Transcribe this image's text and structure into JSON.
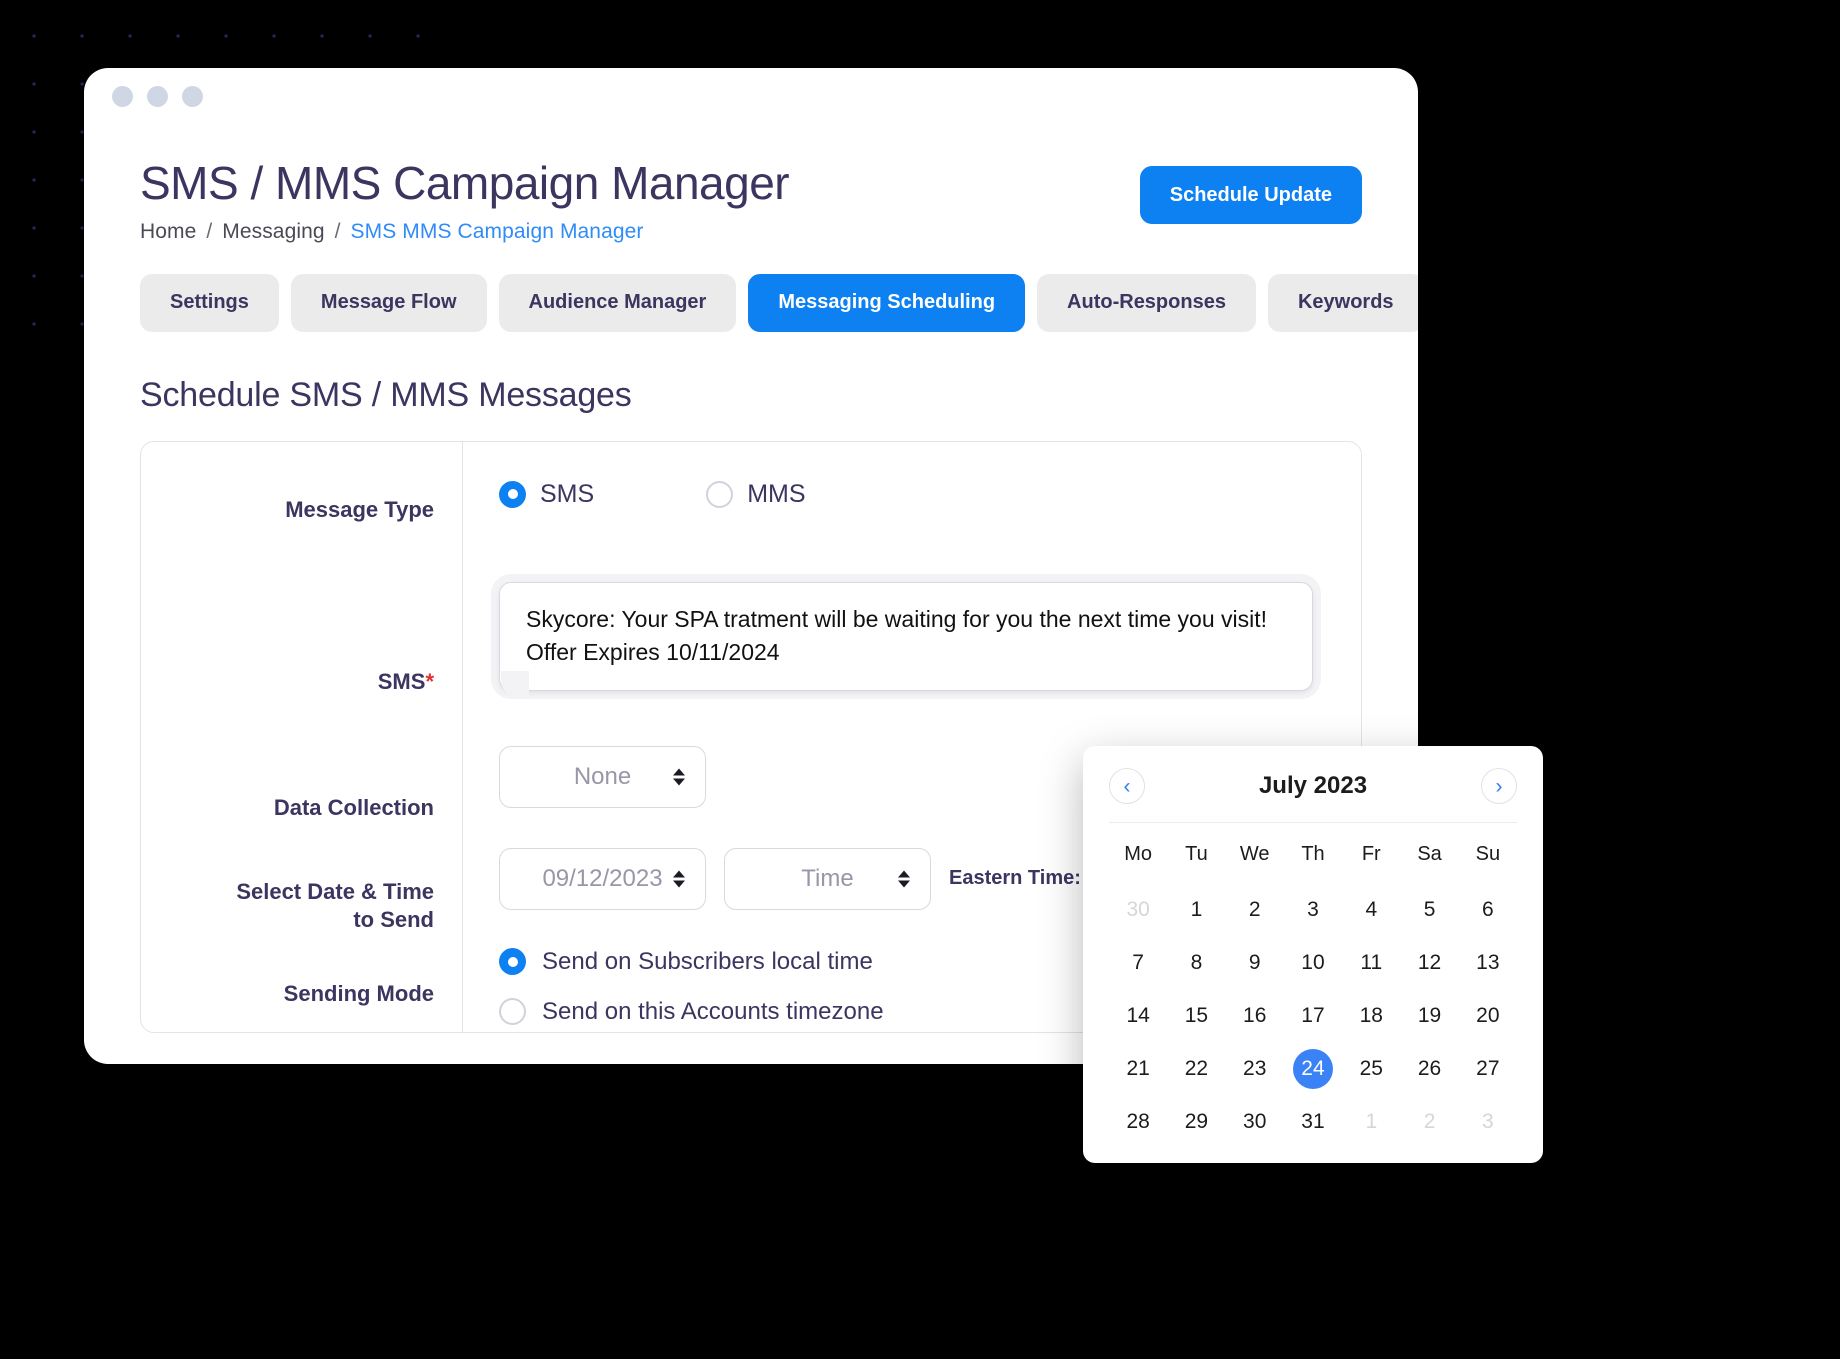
{
  "window": {
    "dots": [
      "dot-1",
      "dot-2",
      "dot-3"
    ]
  },
  "header": {
    "title": "SMS / MMS Campaign Manager",
    "breadcrumb": {
      "home": "Home",
      "section": "Messaging",
      "current": "SMS MMS Campaign Manager",
      "separator": "/"
    },
    "primary_button": "Schedule Update",
    "accent_color": "#0d80f2",
    "title_color": "#3b3560",
    "link_color": "#2f8cf7"
  },
  "tabs": [
    {
      "label": "Settings",
      "active": false
    },
    {
      "label": "Message Flow",
      "active": false
    },
    {
      "label": "Audience Manager",
      "active": false
    },
    {
      "label": "Messaging Scheduling",
      "active": true
    },
    {
      "label": "Auto-Responses",
      "active": false
    },
    {
      "label": "Keywords",
      "active": false
    }
  ],
  "section": {
    "title": "Schedule SMS / MMS Messages"
  },
  "form": {
    "message_type": {
      "label": "Message Type",
      "options": [
        {
          "label": "SMS",
          "checked": true
        },
        {
          "label": "MMS",
          "checked": false
        }
      ]
    },
    "sms": {
      "label": "SMS",
      "required_marker": "*",
      "required_color": "#e03131",
      "value": "Skycore: Your SPA tratment will be waiting for you the next time you visit! Offer Expires 10/11/2024"
    },
    "data_collection": {
      "label": "Data Collection",
      "value": "None"
    },
    "date_time": {
      "label_line1": "Select Date & Time",
      "label_line2": "to Send",
      "date_value": "09/12/2023",
      "time_placeholder": "Time",
      "timezone_note": "Eastern Time: US"
    },
    "sending_mode": {
      "label": "Sending Mode",
      "options": [
        {
          "label": "Send on Subscribers local time",
          "checked": true
        },
        {
          "label": "Send on this Accounts timezone",
          "checked": false
        }
      ]
    }
  },
  "calendar": {
    "month_title": "July 2023",
    "prev_label": "‹",
    "next_label": "›",
    "weekdays": [
      "Mo",
      "Tu",
      "We",
      "Th",
      "Fr",
      "Sa",
      "Su"
    ],
    "selected_day": 24,
    "selected_color": "#3b82f6",
    "days": [
      {
        "n": "30",
        "muted": true
      },
      {
        "n": "1",
        "muted": false
      },
      {
        "n": "2",
        "muted": false
      },
      {
        "n": "3",
        "muted": false
      },
      {
        "n": "4",
        "muted": false
      },
      {
        "n": "5",
        "muted": false
      },
      {
        "n": "6",
        "muted": false
      },
      {
        "n": "7",
        "muted": false
      },
      {
        "n": "8",
        "muted": false
      },
      {
        "n": "9",
        "muted": false
      },
      {
        "n": "10",
        "muted": false
      },
      {
        "n": "11",
        "muted": false
      },
      {
        "n": "12",
        "muted": false
      },
      {
        "n": "13",
        "muted": false
      },
      {
        "n": "14",
        "muted": false
      },
      {
        "n": "15",
        "muted": false
      },
      {
        "n": "16",
        "muted": false
      },
      {
        "n": "17",
        "muted": false
      },
      {
        "n": "18",
        "muted": false
      },
      {
        "n": "19",
        "muted": false
      },
      {
        "n": "20",
        "muted": false
      },
      {
        "n": "21",
        "muted": false
      },
      {
        "n": "22",
        "muted": false
      },
      {
        "n": "23",
        "muted": false
      },
      {
        "n": "24",
        "muted": false,
        "selected": true
      },
      {
        "n": "25",
        "muted": false
      },
      {
        "n": "26",
        "muted": false
      },
      {
        "n": "27",
        "muted": false
      },
      {
        "n": "28",
        "muted": false
      },
      {
        "n": "29",
        "muted": false
      },
      {
        "n": "30",
        "muted": false
      },
      {
        "n": "31",
        "muted": false
      },
      {
        "n": "1",
        "muted": true
      },
      {
        "n": "2",
        "muted": true
      },
      {
        "n": "3",
        "muted": true
      }
    ]
  }
}
